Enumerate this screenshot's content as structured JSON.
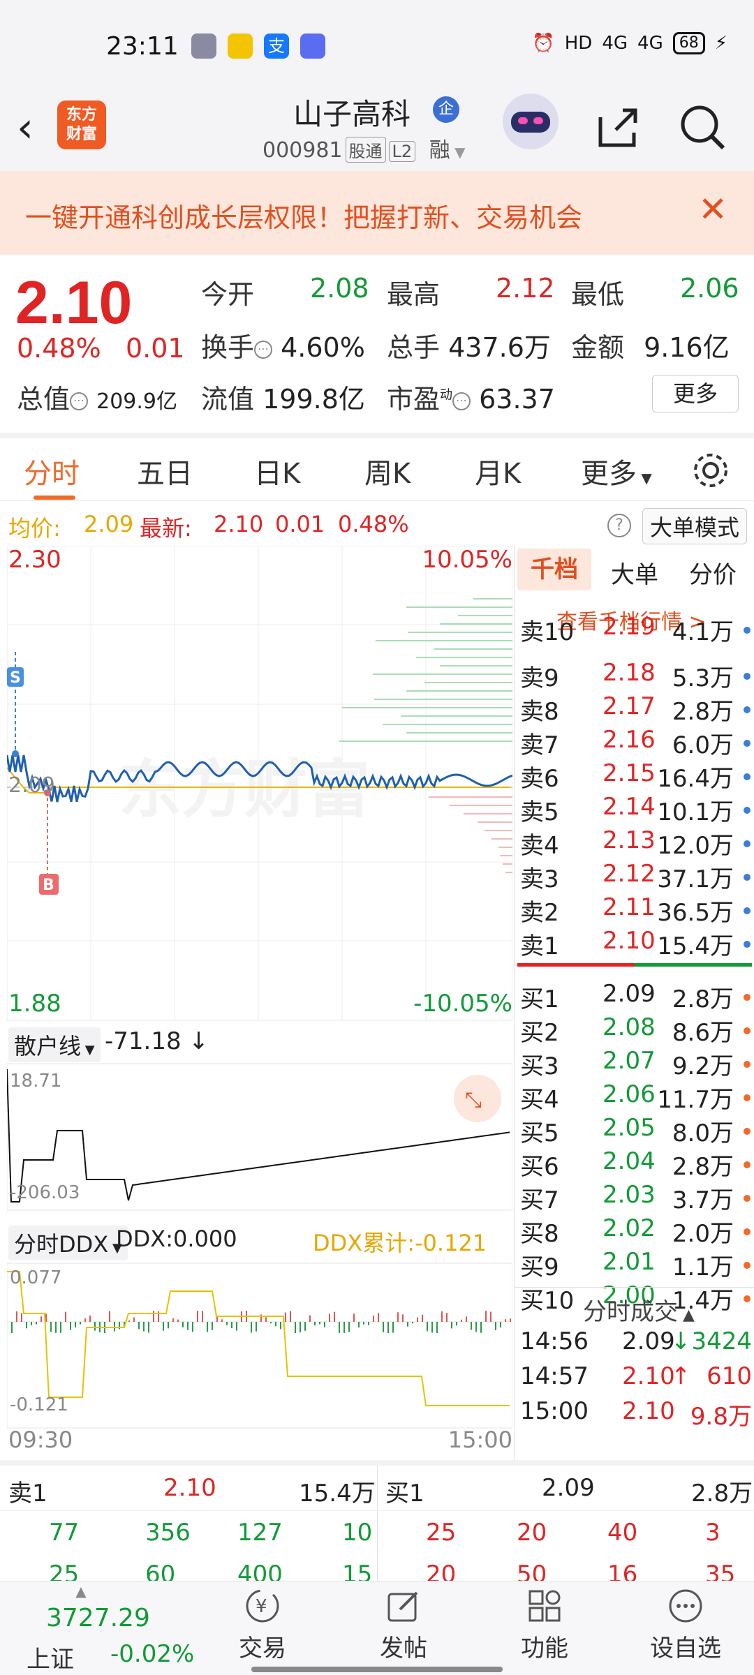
{
  "status": {
    "time": "23:11",
    "battery": "68",
    "signal1": "4G",
    "signal2": "4G",
    "hd": "HD"
  },
  "header": {
    "back_icon": "chevron-left-icon",
    "logo_text": "东方\n财富",
    "stock_name": "山子高科",
    "badge": "企",
    "stock_code": "000981",
    "tag1": "股通",
    "tag2": "L2",
    "tag3": "融"
  },
  "banner": {
    "text": "一键开通科创成长层权限！把握打新、交易机会",
    "close": "✕"
  },
  "quote": {
    "price": "2.10",
    "change_pct": "0.48%",
    "change": "0.01",
    "open_label": "今开",
    "open": "2.08",
    "high_label": "最高",
    "high": "2.12",
    "low_label": "最低",
    "low": "2.06",
    "turnover_label": "换手",
    "turnover": "4.60%",
    "volume_label": "总手",
    "volume": "437.6万",
    "amount_label": "金额",
    "amount": "9.16亿",
    "mktcap_label": "总值",
    "mktcap": "209.9亿",
    "float_label": "流值",
    "float": "199.8亿",
    "pe_label": "市盈",
    "pe_sup": "动",
    "pe": "63.37",
    "more": "更多"
  },
  "tabs": [
    "分时",
    "五日",
    "日K",
    "周K",
    "月K",
    "更多"
  ],
  "avgrow": {
    "avg_label": "均价:",
    "avg": "2.09",
    "latest_label": "最新:",
    "latest": "2.10",
    "chg": "0.01",
    "pct": "0.48%",
    "help": "?",
    "bigmode": "大单模式"
  },
  "chart_labels": {
    "top_price": "2.30",
    "top_pct": "10.05%",
    "bottom_price": "1.88",
    "bottom_pct": "-10.05%",
    "mid_price": "2.09",
    "sell_marker": "S",
    "buy_marker": "B",
    "watermark": "东方财富",
    "retail_label": "散户线",
    "retail_val": "-71.18",
    "retail_arrow": "↓",
    "retail_max": "18.71",
    "retail_min": "-206.03",
    "ddx_label": "分时DDX",
    "ddx_val": "DDX:0.000",
    "ddx_cum": "DDX累计:-0.121",
    "ddx_max": "0.077",
    "ddx_min": "-0.121",
    "time_start": "09:30",
    "time_end": "15:00"
  },
  "book": {
    "tabs": [
      "千档",
      "大单",
      "分价"
    ],
    "view_link": "查看千档行情 >",
    "sells": [
      {
        "n": "卖10",
        "p": "2.19",
        "v": "4.1万"
      },
      {
        "n": "卖9",
        "p": "2.18",
        "v": "5.3万"
      },
      {
        "n": "卖8",
        "p": "2.17",
        "v": "2.8万"
      },
      {
        "n": "卖7",
        "p": "2.16",
        "v": "6.0万"
      },
      {
        "n": "卖6",
        "p": "2.15",
        "v": "16.4万"
      },
      {
        "n": "卖5",
        "p": "2.14",
        "v": "10.1万"
      },
      {
        "n": "卖4",
        "p": "2.13",
        "v": "12.0万"
      },
      {
        "n": "卖3",
        "p": "2.12",
        "v": "37.1万"
      },
      {
        "n": "卖2",
        "p": "2.11",
        "v": "36.5万"
      },
      {
        "n": "卖1",
        "p": "2.10",
        "v": "15.4万"
      }
    ],
    "buys": [
      {
        "n": "买1",
        "p": "2.09",
        "v": "2.8万"
      },
      {
        "n": "买2",
        "p": "2.08",
        "v": "8.6万"
      },
      {
        "n": "买3",
        "p": "2.07",
        "v": "9.2万"
      },
      {
        "n": "买4",
        "p": "2.06",
        "v": "11.7万"
      },
      {
        "n": "买5",
        "p": "2.05",
        "v": "8.0万"
      },
      {
        "n": "买6",
        "p": "2.04",
        "v": "2.8万"
      },
      {
        "n": "买7",
        "p": "2.03",
        "v": "3.7万"
      },
      {
        "n": "买8",
        "p": "2.02",
        "v": "2.0万"
      },
      {
        "n": "买9",
        "p": "2.01",
        "v": "1.1万"
      },
      {
        "n": "买10",
        "p": "2.00",
        "v": "1.4万"
      }
    ],
    "deals_title": "分时成交",
    "deals": [
      {
        "t": "14:56",
        "p": "2.09",
        "arrow": "↓",
        "v": "3424"
      },
      {
        "t": "14:57",
        "p": "2.10",
        "arrow": "↑",
        "v": "610"
      },
      {
        "t": "15:00",
        "p": "2.10",
        "arrow": "",
        "v": "9.8万"
      }
    ]
  },
  "bottom_book": {
    "sell_label": "卖1",
    "sell_price": "2.10",
    "sell_vol": "15.4万",
    "buy_label": "买1",
    "buy_price": "2.09",
    "buy_vol": "2.8万",
    "sell_q1": [
      "77",
      "356",
      "127",
      "10"
    ],
    "sell_q2": [
      "25",
      "60",
      "400",
      "15"
    ],
    "buy_q1": [
      "25",
      "20",
      "40",
      "3"
    ],
    "buy_q2": [
      "20",
      "50",
      "16",
      "35"
    ]
  },
  "nav": {
    "index_value": "3727.29",
    "index_name": "上证",
    "index_chg": "-0.02%",
    "items": [
      "交易",
      "发帖",
      "功能",
      "设自选"
    ]
  },
  "colors": {
    "up": "#e02424",
    "down": "#119a36",
    "accent": "#f06a2a",
    "avg": "#e6a700",
    "line": "#1f5fb0"
  }
}
